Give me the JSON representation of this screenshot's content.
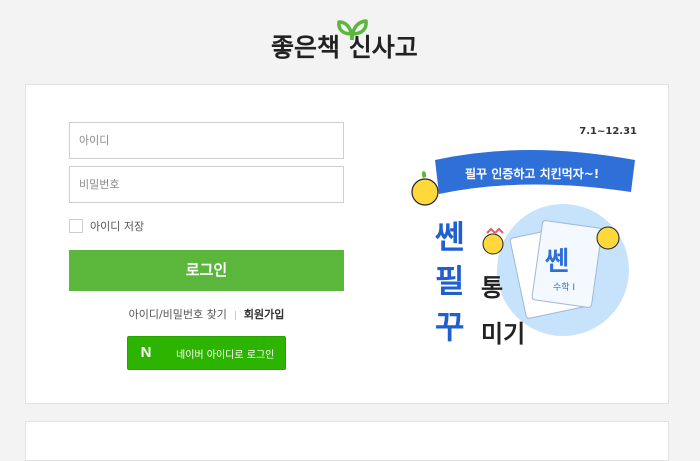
{
  "logo": {
    "text": "좋은책 신사고",
    "brand_color": "#5bb73b"
  },
  "login": {
    "id_placeholder": "아이디",
    "password_placeholder": "비밀번호",
    "remember_label": "아이디 저장",
    "login_button": "로그인",
    "find_link": "아이디/비밀번호 찾기",
    "join_link": "회원가입",
    "naver_icon_letter": "N",
    "naver_button": "네이버 아이디로 로그인"
  },
  "promo": {
    "date_range": "7.1~12.31",
    "banner_text": "필꾸 인증하고 치킨먹자~!",
    "title_chars": [
      "쎈",
      "필",
      "꾸"
    ],
    "side_chars": [
      "통",
      "미기"
    ],
    "book_title": "쎈",
    "book_subtitle": "수학 I"
  },
  "colors": {
    "accent": "#5bb73b",
    "naver": "#2db400",
    "promo_blue": "#2f6fd8"
  }
}
